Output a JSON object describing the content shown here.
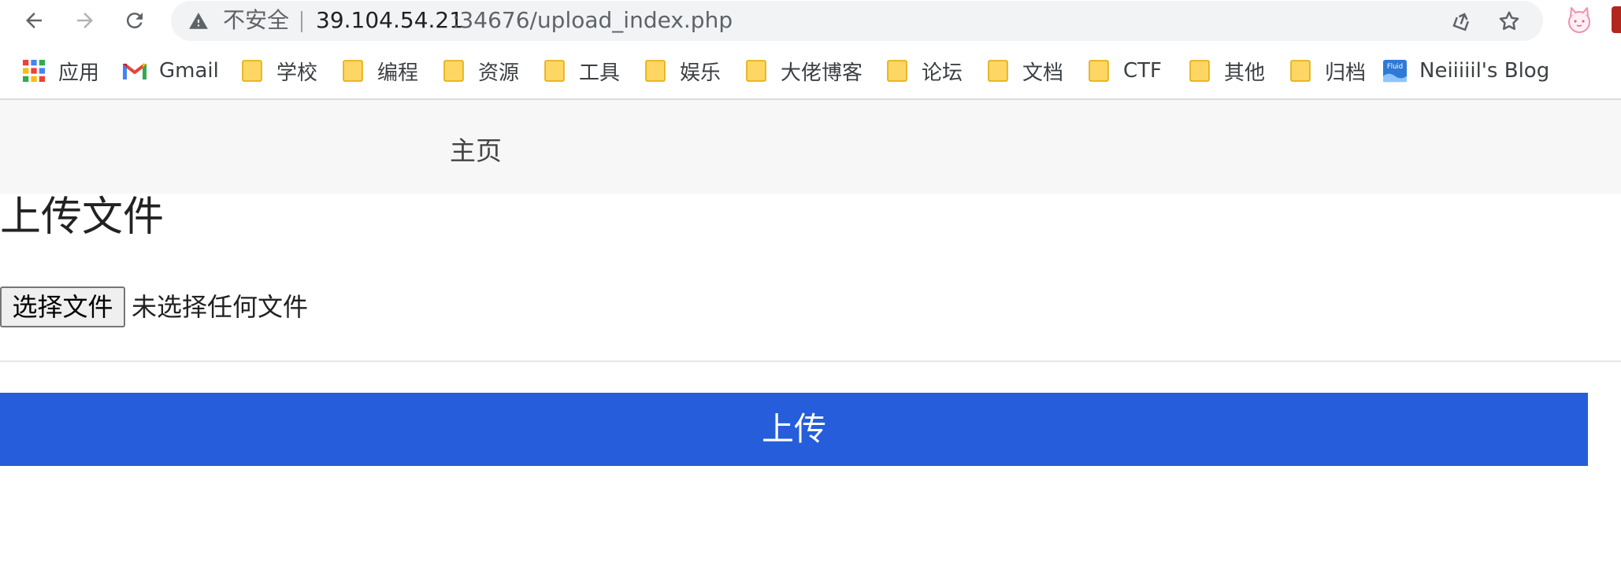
{
  "browser": {
    "security_label": "不安全",
    "url_host": "39.104.54.21",
    "url_rest": ":34676/upload_index.php",
    "icons": [
      "back-icon",
      "forward-icon",
      "reload-icon",
      "warning-icon",
      "share-icon",
      "star-icon",
      "extension-icon"
    ]
  },
  "bookmarks": [
    {
      "label": "应用",
      "icon": "apps-grid-icon"
    },
    {
      "label": "Gmail",
      "icon": "gmail-icon"
    },
    {
      "label": "学校",
      "icon": "folder-icon"
    },
    {
      "label": "编程",
      "icon": "folder-icon"
    },
    {
      "label": "资源",
      "icon": "folder-icon"
    },
    {
      "label": "工具",
      "icon": "folder-icon"
    },
    {
      "label": "娱乐",
      "icon": "folder-icon"
    },
    {
      "label": "大佬博客",
      "icon": "folder-icon"
    },
    {
      "label": "论坛",
      "icon": "folder-icon"
    },
    {
      "label": "文档",
      "icon": "folder-icon"
    },
    {
      "label": "CTF",
      "icon": "folder-icon"
    },
    {
      "label": "其他",
      "icon": "folder-icon"
    },
    {
      "label": "归档",
      "icon": "folder-icon"
    },
    {
      "label": "Neiiiiil's Blog",
      "icon": "fluid-icon",
      "icon_text": "Fluid"
    }
  ],
  "page": {
    "nav_home": "主页",
    "title": "上传文件",
    "file_button": "选择文件",
    "file_status": "未选择任何文件",
    "submit": "上传"
  },
  "colors": {
    "accent": "#255ddb",
    "nav_bg": "#f7f7f7",
    "folder": "#fdd663"
  }
}
